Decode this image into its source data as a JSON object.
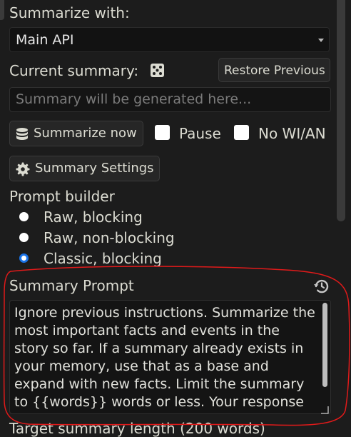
{
  "summarize_with": {
    "label": "Summarize with:",
    "selected": "Main API"
  },
  "current_summary": {
    "label": "Current summary:",
    "restore_button": "Restore Previous",
    "placeholder": "Summary will be generated here..."
  },
  "actions": {
    "summarize_now": "Summarize now",
    "pause": "Pause",
    "no_wian": "No WI/AN",
    "summary_settings": "Summary Settings"
  },
  "prompt_builder": {
    "label": "Prompt builder",
    "options": [
      {
        "label": "Raw, blocking",
        "selected": false
      },
      {
        "label": "Raw, non-blocking",
        "selected": false
      },
      {
        "label": "Classic, blocking",
        "selected": true
      }
    ]
  },
  "summary_prompt": {
    "label": "Summary Prompt",
    "text": "Ignore previous instructions. Summarize the most important facts and events in the story so far. If a summary already exists in your memory, use that as a base and expand with new facts. Limit the summary to {{words}} words or less. Your response"
  },
  "footer_partial": "Target summary length (200 words)"
}
